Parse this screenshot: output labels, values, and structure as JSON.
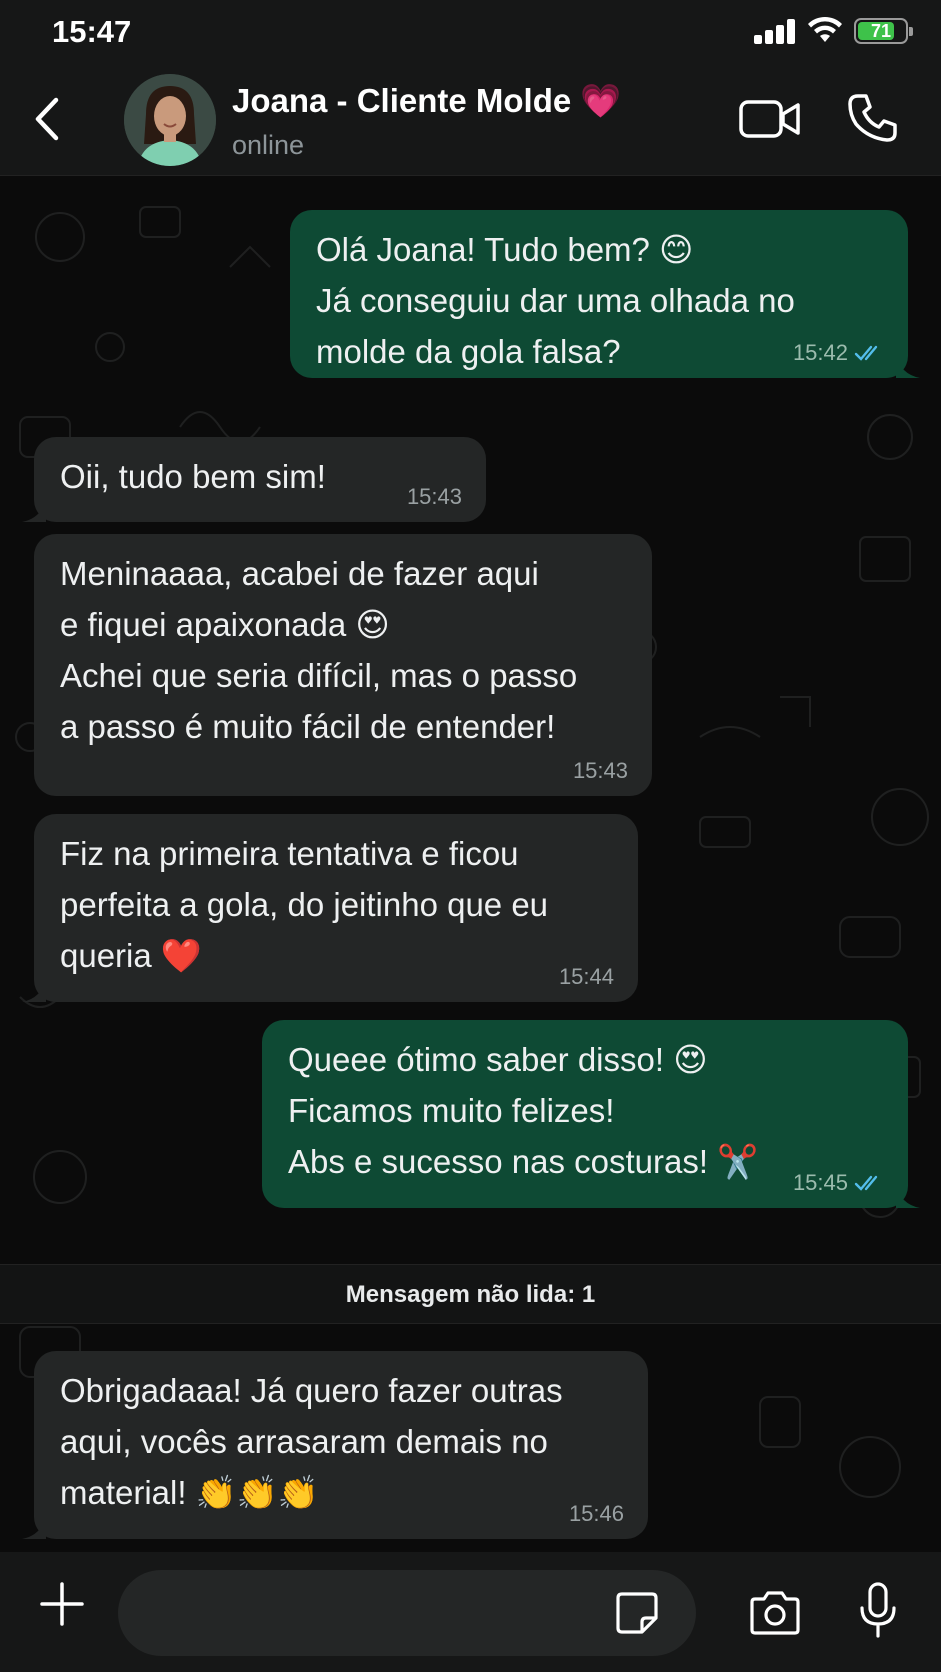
{
  "status_bar": {
    "time": "15:47",
    "battery": "71"
  },
  "header": {
    "contact_name": "Joana - Cliente Molde 💗",
    "status": "online"
  },
  "messages": [
    {
      "direction": "out",
      "lines": [
        "Olá Joana! Tudo bem? 😊",
        "Já conseguiu dar uma olhada no",
        "molde da gola falsa?"
      ],
      "time": "15:42",
      "read": true
    },
    {
      "direction": "in",
      "lines": [
        "Oii, tudo bem sim!"
      ],
      "time": "15:43"
    },
    {
      "direction": "in",
      "lines": [
        "Meninaaaa, acabei de fazer aqui",
        "e fiquei apaixonada 😍",
        "Achei que seria difícil, mas o passo",
        "a passo é muito fácil de entender!"
      ],
      "time": "15:43"
    },
    {
      "direction": "in",
      "lines": [
        "Fiz na primeira tentativa e ficou",
        "perfeita a gola, do jeitinho que eu",
        "queria ❤️"
      ],
      "time": "15:44"
    },
    {
      "direction": "out",
      "lines": [
        "Queee ótimo saber disso! 😍",
        "Ficamos muito felizes!",
        "Abs e sucesso nas costuras! ✂️"
      ],
      "time": "15:45",
      "read": true
    },
    {
      "direction": "in",
      "lines": [
        "Obrigadaaa! Já quero fazer outras",
        "aqui, vocês arrasaram demais no",
        "material! 👏👏👏"
      ],
      "time": "15:46"
    }
  ],
  "unread_banner": "Mensagem não lida: 1",
  "composer": {
    "placeholder": ""
  },
  "icons": {
    "back": "chevron-left-icon",
    "video": "video-camera-icon",
    "call": "phone-icon",
    "plus": "plus-icon",
    "sticker": "sticker-icon",
    "camera": "camera-icon",
    "mic": "microphone-icon",
    "read_receipt": "double-check-icon"
  },
  "colors": {
    "outgoing_bubble": "#0e4a34",
    "incoming_bubble": "#242626",
    "read_tick": "#53bdeb",
    "battery": "#3ec24a"
  }
}
